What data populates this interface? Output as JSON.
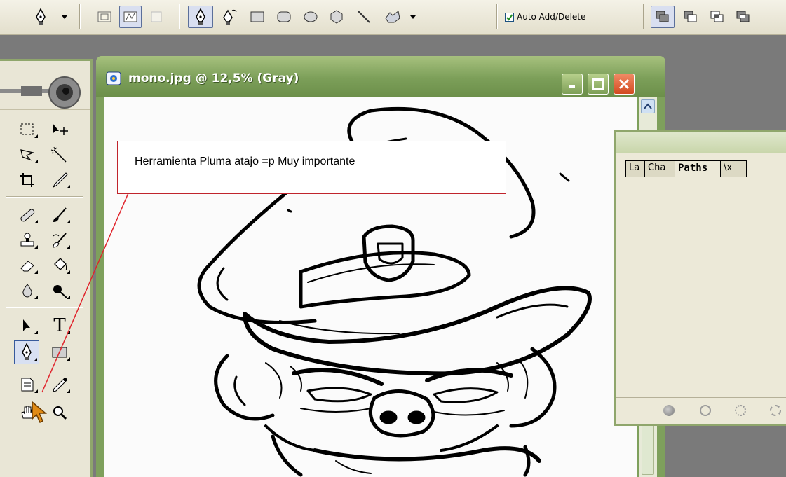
{
  "options_bar": {
    "tools": [
      {
        "icon": "pen-preset-icon",
        "label": ""
      },
      {
        "icon": "dropdown-arrow-icon",
        "label": ""
      },
      {
        "icon": "shape-layers-icon",
        "label": ""
      },
      {
        "icon": "paths-mode-icon",
        "label": ""
      },
      {
        "icon": "fill-pixels-icon",
        "label": ""
      },
      {
        "icon": "pen-icon",
        "label": ""
      },
      {
        "icon": "freeform-pen-icon",
        "label": ""
      },
      {
        "icon": "rectangle-icon",
        "label": ""
      },
      {
        "icon": "rounded-rectangle-icon",
        "label": ""
      },
      {
        "icon": "ellipse-icon",
        "label": ""
      },
      {
        "icon": "polygon-icon",
        "label": ""
      },
      {
        "icon": "line-icon",
        "label": ""
      },
      {
        "icon": "custom-shape-icon",
        "label": ""
      },
      {
        "icon": "dropdown-arrow-icon",
        "label": ""
      }
    ],
    "auto_add_delete_label": "Auto Add/Delete",
    "auto_add_delete_checked": true,
    "path_ops": [
      "add-to-path-icon",
      "subtract-from-path-icon",
      "intersect-path-icon",
      "exclude-overlap-icon"
    ]
  },
  "document": {
    "title": "mono.jpg @ 12,5% (Gray)",
    "controls": [
      "minimize-icon",
      "maximize-icon",
      "close-icon"
    ]
  },
  "callout": {
    "text": "Herramienta Pluma atajo =p  Muy importante"
  },
  "toolbox": {
    "tools": [
      {
        "name": "marquee-tool",
        "icon": "marquee-icon"
      },
      {
        "name": "move-tool",
        "icon": "move-icon"
      },
      {
        "name": "lasso-tool",
        "icon": "lasso-icon"
      },
      {
        "name": "magic-wand-tool",
        "icon": "magic-wand-icon"
      },
      {
        "name": "crop-tool",
        "icon": "crop-icon"
      },
      {
        "name": "slice-tool",
        "icon": "slice-icon"
      },
      {
        "name": "healing-brush-tool",
        "icon": "bandage-icon"
      },
      {
        "name": "brush-tool",
        "icon": "brush-icon"
      },
      {
        "name": "clone-stamp-tool",
        "icon": "stamp-icon"
      },
      {
        "name": "history-brush-tool",
        "icon": "history-brush-icon"
      },
      {
        "name": "eraser-tool",
        "icon": "eraser-icon"
      },
      {
        "name": "paint-bucket-tool",
        "icon": "bucket-icon"
      },
      {
        "name": "blur-tool",
        "icon": "drop-icon"
      },
      {
        "name": "dodge-tool",
        "icon": "dodge-icon"
      },
      {
        "name": "path-selection-tool",
        "icon": "arrow-icon"
      },
      {
        "name": "type-tool",
        "icon": "type-icon",
        "label": "T"
      },
      {
        "name": "pen-tool",
        "icon": "pen-icon",
        "selected": true
      },
      {
        "name": "rectangle-tool",
        "icon": "rectangle-icon"
      },
      {
        "name": "notes-tool",
        "icon": "notes-icon"
      },
      {
        "name": "eyedropper-tool",
        "icon": "eyedropper-icon"
      },
      {
        "name": "hand-tool",
        "icon": "hand-icon"
      },
      {
        "name": "zoom-tool",
        "icon": "zoom-icon"
      }
    ]
  },
  "paths_panel": {
    "tabs": [
      {
        "label": "La",
        "active": false
      },
      {
        "label": "Cha",
        "active": false
      },
      {
        "label": "Paths",
        "active": true
      },
      {
        "label": "\\x",
        "active": false
      }
    ],
    "footer_icons": [
      "fill-path-icon",
      "stroke-path-icon",
      "load-selection-icon",
      "make-work-path-icon"
    ]
  },
  "colors": {
    "window_green": "#7ea05c",
    "callout_border": "#c0242c",
    "pointer_line": "#e0242c"
  }
}
